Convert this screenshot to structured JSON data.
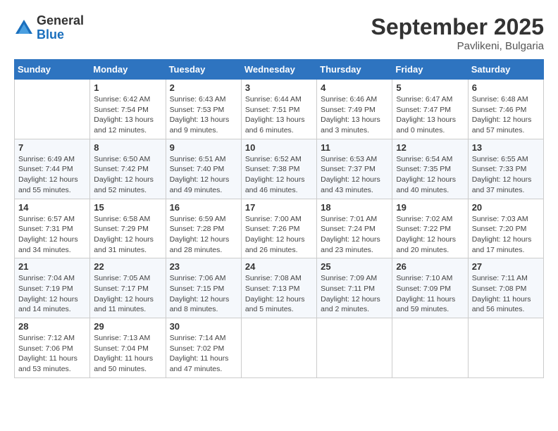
{
  "header": {
    "logo_general": "General",
    "logo_blue": "Blue",
    "month_title": "September 2025",
    "location": "Pavlikeni, Bulgaria"
  },
  "days_of_week": [
    "Sunday",
    "Monday",
    "Tuesday",
    "Wednesday",
    "Thursday",
    "Friday",
    "Saturday"
  ],
  "weeks": [
    [
      {
        "day": "",
        "sunrise": "",
        "sunset": "",
        "daylight": ""
      },
      {
        "day": "1",
        "sunrise": "Sunrise: 6:42 AM",
        "sunset": "Sunset: 7:54 PM",
        "daylight": "Daylight: 13 hours and 12 minutes."
      },
      {
        "day": "2",
        "sunrise": "Sunrise: 6:43 AM",
        "sunset": "Sunset: 7:53 PM",
        "daylight": "Daylight: 13 hours and 9 minutes."
      },
      {
        "day": "3",
        "sunrise": "Sunrise: 6:44 AM",
        "sunset": "Sunset: 7:51 PM",
        "daylight": "Daylight: 13 hours and 6 minutes."
      },
      {
        "day": "4",
        "sunrise": "Sunrise: 6:46 AM",
        "sunset": "Sunset: 7:49 PM",
        "daylight": "Daylight: 13 hours and 3 minutes."
      },
      {
        "day": "5",
        "sunrise": "Sunrise: 6:47 AM",
        "sunset": "Sunset: 7:47 PM",
        "daylight": "Daylight: 13 hours and 0 minutes."
      },
      {
        "day": "6",
        "sunrise": "Sunrise: 6:48 AM",
        "sunset": "Sunset: 7:46 PM",
        "daylight": "Daylight: 12 hours and 57 minutes."
      }
    ],
    [
      {
        "day": "7",
        "sunrise": "Sunrise: 6:49 AM",
        "sunset": "Sunset: 7:44 PM",
        "daylight": "Daylight: 12 hours and 55 minutes."
      },
      {
        "day": "8",
        "sunrise": "Sunrise: 6:50 AM",
        "sunset": "Sunset: 7:42 PM",
        "daylight": "Daylight: 12 hours and 52 minutes."
      },
      {
        "day": "9",
        "sunrise": "Sunrise: 6:51 AM",
        "sunset": "Sunset: 7:40 PM",
        "daylight": "Daylight: 12 hours and 49 minutes."
      },
      {
        "day": "10",
        "sunrise": "Sunrise: 6:52 AM",
        "sunset": "Sunset: 7:38 PM",
        "daylight": "Daylight: 12 hours and 46 minutes."
      },
      {
        "day": "11",
        "sunrise": "Sunrise: 6:53 AM",
        "sunset": "Sunset: 7:37 PM",
        "daylight": "Daylight: 12 hours and 43 minutes."
      },
      {
        "day": "12",
        "sunrise": "Sunrise: 6:54 AM",
        "sunset": "Sunset: 7:35 PM",
        "daylight": "Daylight: 12 hours and 40 minutes."
      },
      {
        "day": "13",
        "sunrise": "Sunrise: 6:55 AM",
        "sunset": "Sunset: 7:33 PM",
        "daylight": "Daylight: 12 hours and 37 minutes."
      }
    ],
    [
      {
        "day": "14",
        "sunrise": "Sunrise: 6:57 AM",
        "sunset": "Sunset: 7:31 PM",
        "daylight": "Daylight: 12 hours and 34 minutes."
      },
      {
        "day": "15",
        "sunrise": "Sunrise: 6:58 AM",
        "sunset": "Sunset: 7:29 PM",
        "daylight": "Daylight: 12 hours and 31 minutes."
      },
      {
        "day": "16",
        "sunrise": "Sunrise: 6:59 AM",
        "sunset": "Sunset: 7:28 PM",
        "daylight": "Daylight: 12 hours and 28 minutes."
      },
      {
        "day": "17",
        "sunrise": "Sunrise: 7:00 AM",
        "sunset": "Sunset: 7:26 PM",
        "daylight": "Daylight: 12 hours and 26 minutes."
      },
      {
        "day": "18",
        "sunrise": "Sunrise: 7:01 AM",
        "sunset": "Sunset: 7:24 PM",
        "daylight": "Daylight: 12 hours and 23 minutes."
      },
      {
        "day": "19",
        "sunrise": "Sunrise: 7:02 AM",
        "sunset": "Sunset: 7:22 PM",
        "daylight": "Daylight: 12 hours and 20 minutes."
      },
      {
        "day": "20",
        "sunrise": "Sunrise: 7:03 AM",
        "sunset": "Sunset: 7:20 PM",
        "daylight": "Daylight: 12 hours and 17 minutes."
      }
    ],
    [
      {
        "day": "21",
        "sunrise": "Sunrise: 7:04 AM",
        "sunset": "Sunset: 7:19 PM",
        "daylight": "Daylight: 12 hours and 14 minutes."
      },
      {
        "day": "22",
        "sunrise": "Sunrise: 7:05 AM",
        "sunset": "Sunset: 7:17 PM",
        "daylight": "Daylight: 12 hours and 11 minutes."
      },
      {
        "day": "23",
        "sunrise": "Sunrise: 7:06 AM",
        "sunset": "Sunset: 7:15 PM",
        "daylight": "Daylight: 12 hours and 8 minutes."
      },
      {
        "day": "24",
        "sunrise": "Sunrise: 7:08 AM",
        "sunset": "Sunset: 7:13 PM",
        "daylight": "Daylight: 12 hours and 5 minutes."
      },
      {
        "day": "25",
        "sunrise": "Sunrise: 7:09 AM",
        "sunset": "Sunset: 7:11 PM",
        "daylight": "Daylight: 12 hours and 2 minutes."
      },
      {
        "day": "26",
        "sunrise": "Sunrise: 7:10 AM",
        "sunset": "Sunset: 7:09 PM",
        "daylight": "Daylight: 11 hours and 59 minutes."
      },
      {
        "day": "27",
        "sunrise": "Sunrise: 7:11 AM",
        "sunset": "Sunset: 7:08 PM",
        "daylight": "Daylight: 11 hours and 56 minutes."
      }
    ],
    [
      {
        "day": "28",
        "sunrise": "Sunrise: 7:12 AM",
        "sunset": "Sunset: 7:06 PM",
        "daylight": "Daylight: 11 hours and 53 minutes."
      },
      {
        "day": "29",
        "sunrise": "Sunrise: 7:13 AM",
        "sunset": "Sunset: 7:04 PM",
        "daylight": "Daylight: 11 hours and 50 minutes."
      },
      {
        "day": "30",
        "sunrise": "Sunrise: 7:14 AM",
        "sunset": "Sunset: 7:02 PM",
        "daylight": "Daylight: 11 hours and 47 minutes."
      },
      {
        "day": "",
        "sunrise": "",
        "sunset": "",
        "daylight": ""
      },
      {
        "day": "",
        "sunrise": "",
        "sunset": "",
        "daylight": ""
      },
      {
        "day": "",
        "sunrise": "",
        "sunset": "",
        "daylight": ""
      },
      {
        "day": "",
        "sunrise": "",
        "sunset": "",
        "daylight": ""
      }
    ]
  ]
}
